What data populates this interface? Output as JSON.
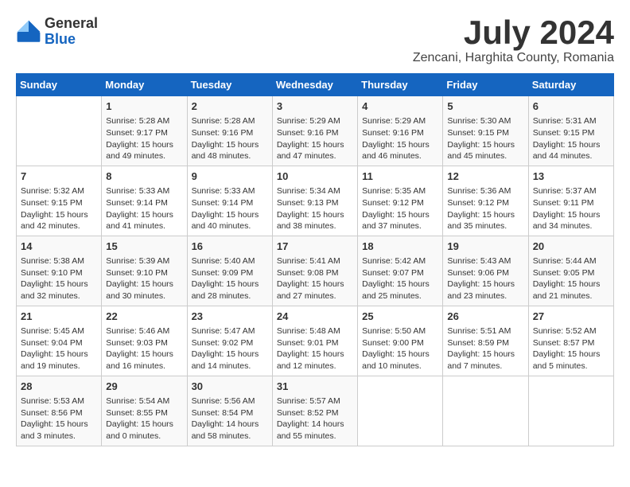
{
  "header": {
    "logo_general": "General",
    "logo_blue": "Blue",
    "title": "July 2024",
    "subtitle": "Zencani, Harghita County, Romania"
  },
  "weekdays": [
    "Sunday",
    "Monday",
    "Tuesday",
    "Wednesday",
    "Thursday",
    "Friday",
    "Saturday"
  ],
  "weeks": [
    [
      {
        "day": "",
        "info": ""
      },
      {
        "day": "1",
        "info": "Sunrise: 5:28 AM\nSunset: 9:17 PM\nDaylight: 15 hours\nand 49 minutes."
      },
      {
        "day": "2",
        "info": "Sunrise: 5:28 AM\nSunset: 9:16 PM\nDaylight: 15 hours\nand 48 minutes."
      },
      {
        "day": "3",
        "info": "Sunrise: 5:29 AM\nSunset: 9:16 PM\nDaylight: 15 hours\nand 47 minutes."
      },
      {
        "day": "4",
        "info": "Sunrise: 5:29 AM\nSunset: 9:16 PM\nDaylight: 15 hours\nand 46 minutes."
      },
      {
        "day": "5",
        "info": "Sunrise: 5:30 AM\nSunset: 9:15 PM\nDaylight: 15 hours\nand 45 minutes."
      },
      {
        "day": "6",
        "info": "Sunrise: 5:31 AM\nSunset: 9:15 PM\nDaylight: 15 hours\nand 44 minutes."
      }
    ],
    [
      {
        "day": "7",
        "info": "Sunrise: 5:32 AM\nSunset: 9:15 PM\nDaylight: 15 hours\nand 42 minutes."
      },
      {
        "day": "8",
        "info": "Sunrise: 5:33 AM\nSunset: 9:14 PM\nDaylight: 15 hours\nand 41 minutes."
      },
      {
        "day": "9",
        "info": "Sunrise: 5:33 AM\nSunset: 9:14 PM\nDaylight: 15 hours\nand 40 minutes."
      },
      {
        "day": "10",
        "info": "Sunrise: 5:34 AM\nSunset: 9:13 PM\nDaylight: 15 hours\nand 38 minutes."
      },
      {
        "day": "11",
        "info": "Sunrise: 5:35 AM\nSunset: 9:12 PM\nDaylight: 15 hours\nand 37 minutes."
      },
      {
        "day": "12",
        "info": "Sunrise: 5:36 AM\nSunset: 9:12 PM\nDaylight: 15 hours\nand 35 minutes."
      },
      {
        "day": "13",
        "info": "Sunrise: 5:37 AM\nSunset: 9:11 PM\nDaylight: 15 hours\nand 34 minutes."
      }
    ],
    [
      {
        "day": "14",
        "info": "Sunrise: 5:38 AM\nSunset: 9:10 PM\nDaylight: 15 hours\nand 32 minutes."
      },
      {
        "day": "15",
        "info": "Sunrise: 5:39 AM\nSunset: 9:10 PM\nDaylight: 15 hours\nand 30 minutes."
      },
      {
        "day": "16",
        "info": "Sunrise: 5:40 AM\nSunset: 9:09 PM\nDaylight: 15 hours\nand 28 minutes."
      },
      {
        "day": "17",
        "info": "Sunrise: 5:41 AM\nSunset: 9:08 PM\nDaylight: 15 hours\nand 27 minutes."
      },
      {
        "day": "18",
        "info": "Sunrise: 5:42 AM\nSunset: 9:07 PM\nDaylight: 15 hours\nand 25 minutes."
      },
      {
        "day": "19",
        "info": "Sunrise: 5:43 AM\nSunset: 9:06 PM\nDaylight: 15 hours\nand 23 minutes."
      },
      {
        "day": "20",
        "info": "Sunrise: 5:44 AM\nSunset: 9:05 PM\nDaylight: 15 hours\nand 21 minutes."
      }
    ],
    [
      {
        "day": "21",
        "info": "Sunrise: 5:45 AM\nSunset: 9:04 PM\nDaylight: 15 hours\nand 19 minutes."
      },
      {
        "day": "22",
        "info": "Sunrise: 5:46 AM\nSunset: 9:03 PM\nDaylight: 15 hours\nand 16 minutes."
      },
      {
        "day": "23",
        "info": "Sunrise: 5:47 AM\nSunset: 9:02 PM\nDaylight: 15 hours\nand 14 minutes."
      },
      {
        "day": "24",
        "info": "Sunrise: 5:48 AM\nSunset: 9:01 PM\nDaylight: 15 hours\nand 12 minutes."
      },
      {
        "day": "25",
        "info": "Sunrise: 5:50 AM\nSunset: 9:00 PM\nDaylight: 15 hours\nand 10 minutes."
      },
      {
        "day": "26",
        "info": "Sunrise: 5:51 AM\nSunset: 8:59 PM\nDaylight: 15 hours\nand 7 minutes."
      },
      {
        "day": "27",
        "info": "Sunrise: 5:52 AM\nSunset: 8:57 PM\nDaylight: 15 hours\nand 5 minutes."
      }
    ],
    [
      {
        "day": "28",
        "info": "Sunrise: 5:53 AM\nSunset: 8:56 PM\nDaylight: 15 hours\nand 3 minutes."
      },
      {
        "day": "29",
        "info": "Sunrise: 5:54 AM\nSunset: 8:55 PM\nDaylight: 15 hours\nand 0 minutes."
      },
      {
        "day": "30",
        "info": "Sunrise: 5:56 AM\nSunset: 8:54 PM\nDaylight: 14 hours\nand 58 minutes."
      },
      {
        "day": "31",
        "info": "Sunrise: 5:57 AM\nSunset: 8:52 PM\nDaylight: 14 hours\nand 55 minutes."
      },
      {
        "day": "",
        "info": ""
      },
      {
        "day": "",
        "info": ""
      },
      {
        "day": "",
        "info": ""
      }
    ]
  ]
}
